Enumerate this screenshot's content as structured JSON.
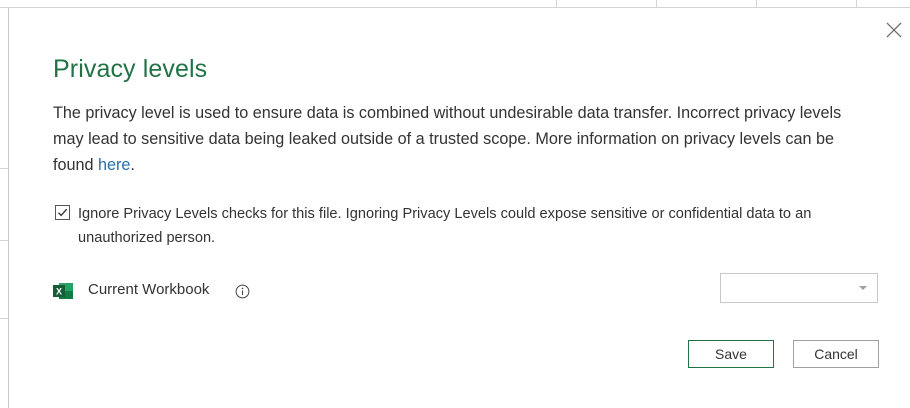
{
  "dialog": {
    "title": "Privacy levels",
    "description": "The privacy level is used to ensure data is combined without undesirable data transfer. Incorrect privacy levels may lead to sensitive data being leaked outside of a trusted scope. More information on privacy levels can be found ",
    "link_text": "here",
    "description_end": ".",
    "ignore_checkbox": {
      "checked": true,
      "label": "Ignore Privacy Levels checks for this file. Ignoring Privacy Levels could expose sensitive or confidential data to an unauthorized person."
    },
    "source": {
      "label": "Current Workbook",
      "icon": "excel-icon",
      "privacy_level_value": ""
    },
    "buttons": {
      "save": "Save",
      "cancel": "Cancel"
    }
  },
  "colors": {
    "accent": "#217346",
    "link": "#2b6cb0",
    "text": "#333333"
  }
}
